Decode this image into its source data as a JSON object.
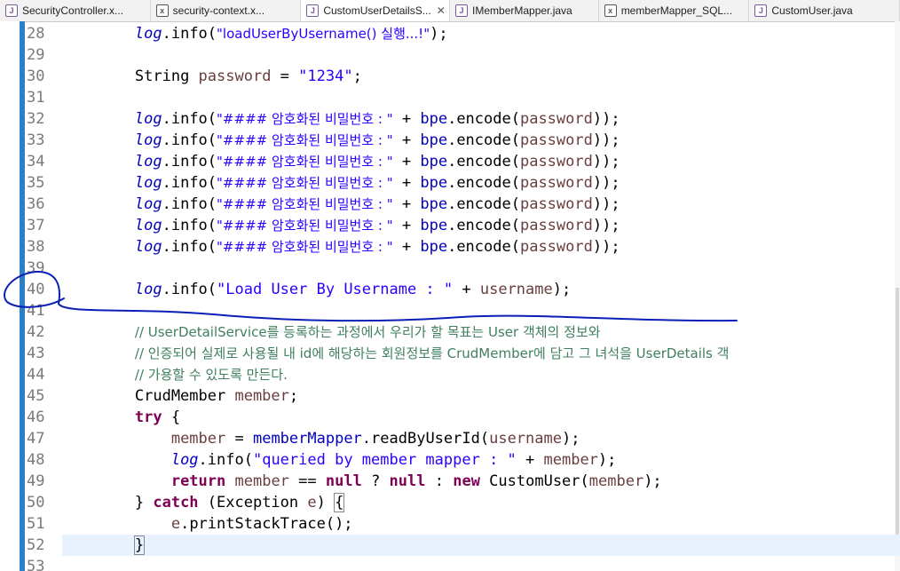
{
  "tabs": [
    {
      "label": "SecurityController.x...",
      "icon": "java-file-icon",
      "active": false
    },
    {
      "label": "security-context.x...",
      "icon": "xml-file-icon",
      "active": false
    },
    {
      "label": "CustomUserDetailsS...",
      "icon": "java-file-icon",
      "active": true,
      "close": "✕"
    },
    {
      "label": "IMemberMapper.java",
      "icon": "java-file-icon",
      "active": false
    },
    {
      "label": "memberMapper_SQL...",
      "icon": "xml-file-icon",
      "active": false
    },
    {
      "label": "CustomUser.java",
      "icon": "java-file-icon",
      "active": false
    }
  ],
  "lines": [
    {
      "n": "28"
    },
    {
      "n": "29"
    },
    {
      "n": "30"
    },
    {
      "n": "31"
    },
    {
      "n": "32"
    },
    {
      "n": "33"
    },
    {
      "n": "34"
    },
    {
      "n": "35"
    },
    {
      "n": "36"
    },
    {
      "n": "37"
    },
    {
      "n": "38"
    },
    {
      "n": "39"
    },
    {
      "n": "40"
    },
    {
      "n": "41"
    },
    {
      "n": "42"
    },
    {
      "n": "43"
    },
    {
      "n": "44"
    },
    {
      "n": "45"
    },
    {
      "n": "46"
    },
    {
      "n": "47"
    },
    {
      "n": "48"
    },
    {
      "n": "49"
    },
    {
      "n": "50"
    },
    {
      "n": "51"
    },
    {
      "n": "52"
    },
    {
      "n": "53"
    }
  ],
  "code": {
    "l28_str": "\"loadUserByUsername() 실행...!\"",
    "l30_type": "String ",
    "l30_var": "password",
    "l30_str": "\"1234\"",
    "hash_str": "\"#### 암호화된 비밀번호 : \"",
    "l40_str": "\"Load User By Username : \"",
    "c42": "// UserDetailService를 등록하는 과정에서 우리가 할 목표는 User 객체의 정보와",
    "c43": "// 인증되어 실제로 사용될 내 id에 해당하는 회원정보를 CrudMember에 담고 그 녀석을 UserDetails 객",
    "c44": "// 가용할 수 있도록 만든다.",
    "l48_str": "\"queried by member mapper : \""
  },
  "colors": {
    "keyword": "#7f0055",
    "string": "#2a00ff",
    "comment": "#3f7f5f",
    "field": "#0000c0",
    "local_var": "#6a3e3e",
    "current_line": "#e8f2fe",
    "annotation": "#0a1fb5"
  }
}
